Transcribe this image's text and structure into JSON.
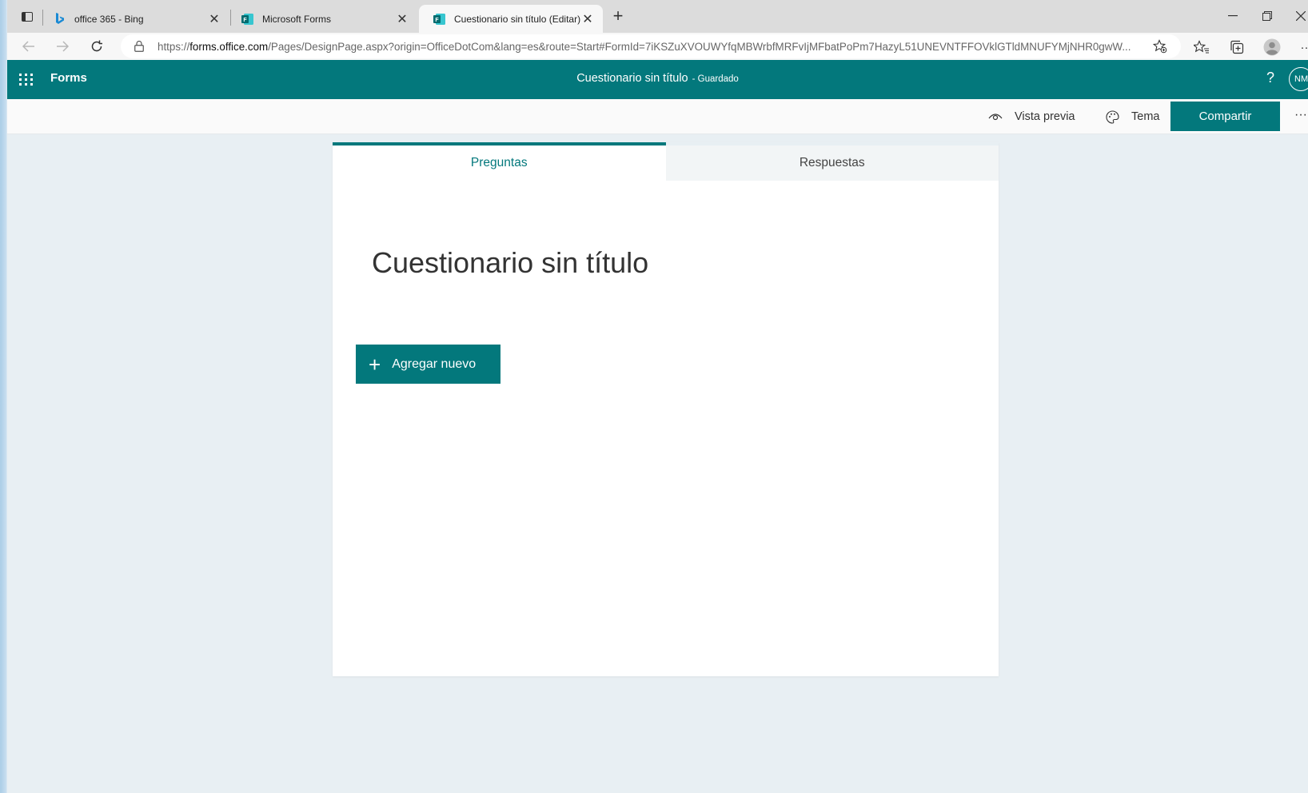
{
  "browser": {
    "tabs": [
      {
        "label": "office 365 - Bing",
        "icon": "bing-icon"
      },
      {
        "label": "Microsoft Forms",
        "icon": "forms-icon"
      },
      {
        "label": "Cuestionario sin título (Editar) M",
        "icon": "forms-icon"
      }
    ],
    "close_glyph": "✕",
    "new_tab_glyph": "+",
    "url_prefix": "https://",
    "url_domain": "forms.office.com",
    "url_rest": "/Pages/DesignPage.aspx?origin=OfficeDotCom&lang=es&route=Start#FormId=7iKSZuXVOUWYfqMBWrbfMRFvIjMFbatPoPm7HazyL51UNEVNTFFOVklGTldMNUFYMjNHR0gwW..."
  },
  "header": {
    "brand": "Forms",
    "doc_title": "Cuestionario sin título",
    "status": "- Guardado",
    "help": "?",
    "avatar_initials": "NM"
  },
  "commands": {
    "preview": "Vista previa",
    "theme": "Tema",
    "share": "Compartir",
    "more": "···"
  },
  "card": {
    "tabs": [
      "Preguntas",
      "Respuestas"
    ],
    "title": "Cuestionario sin título",
    "add_new": "Agregar nuevo",
    "add_glyph": "+"
  },
  "colors": {
    "accent": "#03787c"
  }
}
